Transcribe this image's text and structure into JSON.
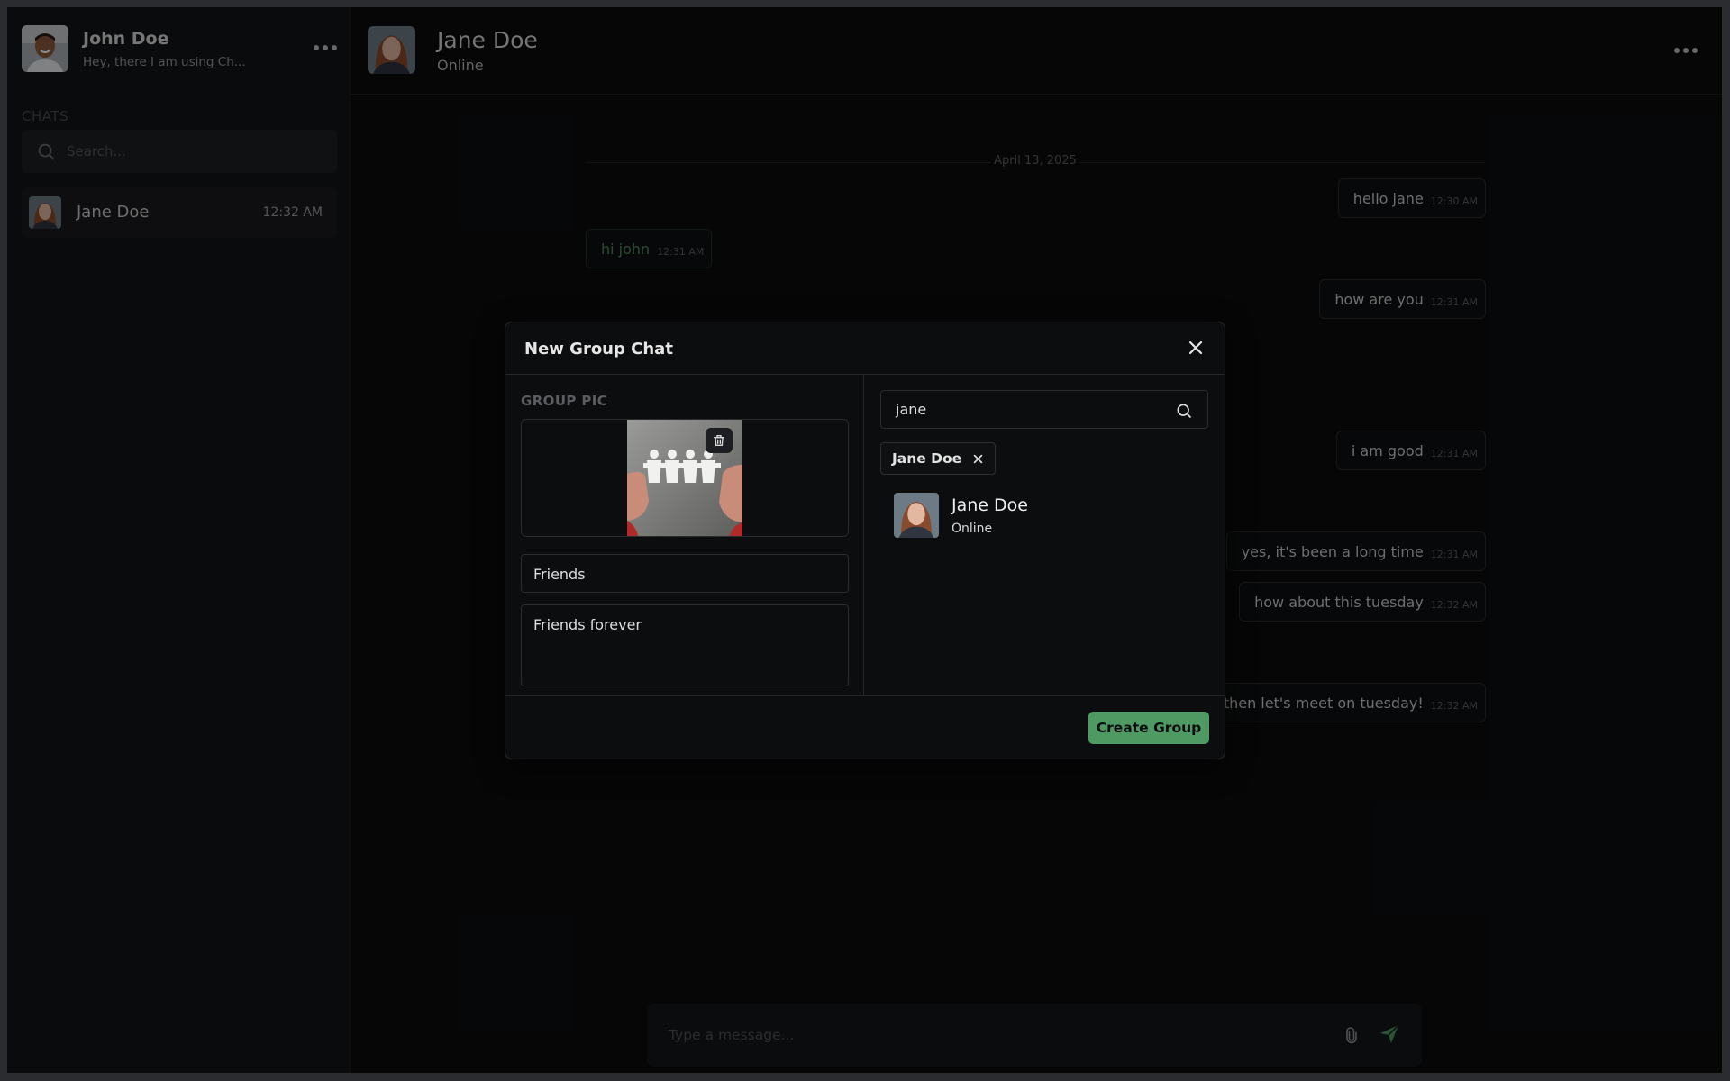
{
  "user": {
    "name": "John Doe",
    "status": "Hey, there I am using Ch..."
  },
  "sidebar": {
    "section_label": "CHATS",
    "search_placeholder": "Search...",
    "chats": [
      {
        "name": "Jane Doe",
        "time": "12:32 AM"
      }
    ]
  },
  "conversation": {
    "name": "Jane Doe",
    "status": "Online",
    "date": "April 13, 2025",
    "messages": [
      {
        "text": "hello jane",
        "time": "12:30 AM",
        "direction": "out"
      },
      {
        "text": "hi john",
        "time": "12:31 AM",
        "direction": "in"
      },
      {
        "text": "how are you",
        "time": "12:31 AM",
        "direction": "out"
      },
      {
        "text": "i am good",
        "time": "12:31 AM",
        "direction": "out"
      },
      {
        "text": "yes, it's been a long time",
        "time": "12:31 AM",
        "direction": "out"
      },
      {
        "text": "how about this tuesday",
        "time": "12:32 AM",
        "direction": "out"
      },
      {
        "text": "ok, then let's meet on tuesday!",
        "time": "12:32 AM",
        "direction": "out"
      }
    ],
    "composer_placeholder": "Type a message..."
  },
  "modal": {
    "title": "New Group Chat",
    "group_pic_label": "GROUP PIC",
    "group_name": "Friends",
    "group_description": "Friends forever",
    "search_value": "jane",
    "selected_chips": [
      "Jane Doe"
    ],
    "results": [
      {
        "name": "Jane Doe",
        "status": "Online"
      }
    ],
    "create_label": "Create Group"
  },
  "colors": {
    "accent": "#4f9a63",
    "background": "#0b0c0e",
    "sidebar": "#131416"
  },
  "icons": {
    "menu": "more-horizontal-icon",
    "search": "search-icon",
    "close": "close-icon",
    "trash": "trash-icon",
    "attach": "paperclip-icon",
    "send": "send-icon"
  }
}
